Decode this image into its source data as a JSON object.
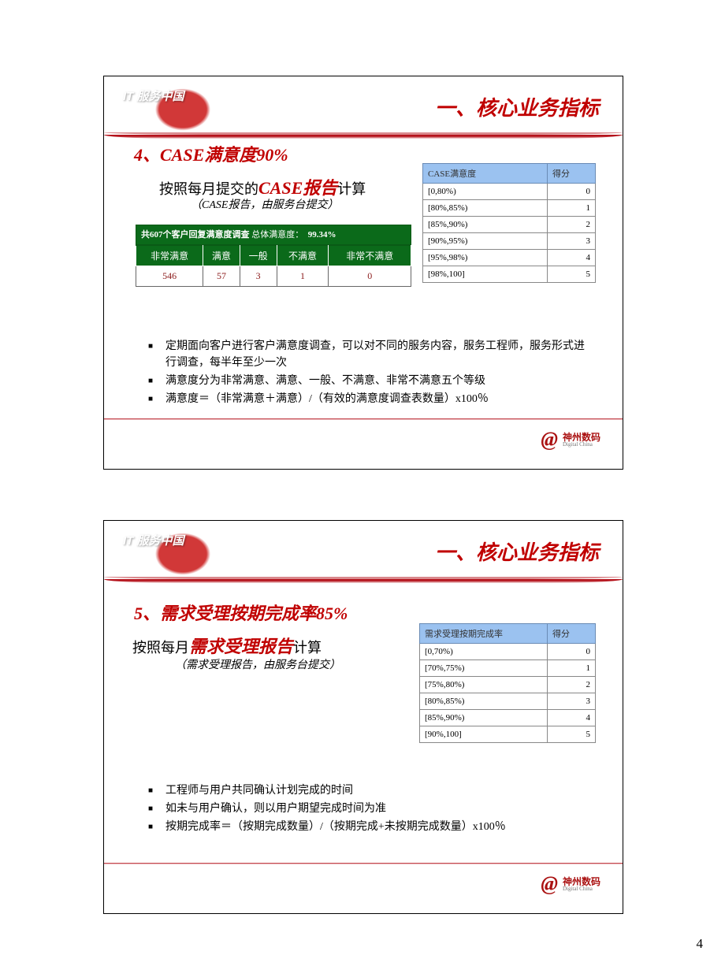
{
  "page_number": "4",
  "common": {
    "section_title": "一、核心业务指标",
    "it_badge": "IT 服务中国",
    "footer_cn": "神州数码",
    "footer_en": "Digital China",
    "footer_swirl": "@"
  },
  "slide1": {
    "subtitle": "4、CASE满意度90%",
    "desc_pre": "按照每月提交的",
    "desc_em": "CASE报告",
    "desc_post": "计算",
    "desc_sub": "（CASE报告，由服务台提交）",
    "score_table": {
      "header": [
        "CASE满意度",
        "得分"
      ],
      "rows": [
        [
          "[0,80%)",
          "0"
        ],
        [
          "[80%,85%)",
          "1"
        ],
        [
          "[85%,90%)",
          "2"
        ],
        [
          "[90%,95%)",
          "3"
        ],
        [
          "[95%,98%)",
          "4"
        ],
        [
          "[98%,100]",
          "5"
        ]
      ]
    },
    "survey": {
      "summary_a": "共607个客户回复满意度调查",
      "summary_b": " 总体满意度：",
      "summary_pct": "99.34%",
      "headers": [
        "非常满意",
        "满意",
        "一般",
        "不满意",
        "非常不满意"
      ],
      "values": [
        "546",
        "57",
        "3",
        "1",
        "0"
      ]
    },
    "bullets": [
      "定期面向客户进行客户满意度调查，可以对不同的服务内容，服务工程师，服务形式进行调查，每半年至少一次",
      "满意度分为非常满意、满意、一般、不满意、非常不满意五个等级",
      "满意度＝（非常满意＋满意）/（有效的满意度调查表数量）x100％"
    ]
  },
  "slide2": {
    "subtitle": "5、需求受理按期完成率85%",
    "desc_pre": "按照每月",
    "desc_em": "需求受理报告",
    "desc_post": "计算",
    "desc_sub": "（需求受理报告，由服务台提交）",
    "score_table": {
      "header": [
        "需求受理按期完成率",
        "得分"
      ],
      "rows": [
        [
          "[0,70%)",
          "0"
        ],
        [
          "[70%,75%)",
          "1"
        ],
        [
          "[75%,80%)",
          "2"
        ],
        [
          "[80%,85%)",
          "3"
        ],
        [
          "[85%,90%)",
          "4"
        ],
        [
          "[90%,100]",
          "5"
        ]
      ]
    },
    "bullets": [
      "工程师与用户共同确认计划完成的时间",
      "如未与用户确认，则以用户期望完成时间为准",
      "按期完成率＝（按期完成数量）/（按期完成+未按期完成数量）x100％"
    ]
  },
  "chart_data": [
    {
      "type": "table",
      "title": "CASE满意度 得分",
      "columns": [
        "CASE满意度",
        "得分"
      ],
      "rows": [
        [
          "[0,80%)",
          0
        ],
        [
          "[80%,85%)",
          1
        ],
        [
          "[85%,90%)",
          2
        ],
        [
          "[90%,95%)",
          3
        ],
        [
          "[95%,98%)",
          4
        ],
        [
          "[98%,100]",
          5
        ]
      ]
    },
    {
      "type": "table",
      "title": "客户回复满意度调查",
      "summary": "共607个客户回复满意度调查 总体满意度： 99.34%",
      "columns": [
        "非常满意",
        "满意",
        "一般",
        "不满意",
        "非常不满意"
      ],
      "rows": [
        [
          546,
          57,
          3,
          1,
          0
        ]
      ]
    },
    {
      "type": "table",
      "title": "需求受理按期完成率 得分",
      "columns": [
        "需求受理按期完成率",
        "得分"
      ],
      "rows": [
        [
          "[0,70%)",
          0
        ],
        [
          "[70%,75%)",
          1
        ],
        [
          "[75%,80%)",
          2
        ],
        [
          "[80%,85%)",
          3
        ],
        [
          "[85%,90%)",
          4
        ],
        [
          "[90%,100]",
          5
        ]
      ]
    }
  ]
}
